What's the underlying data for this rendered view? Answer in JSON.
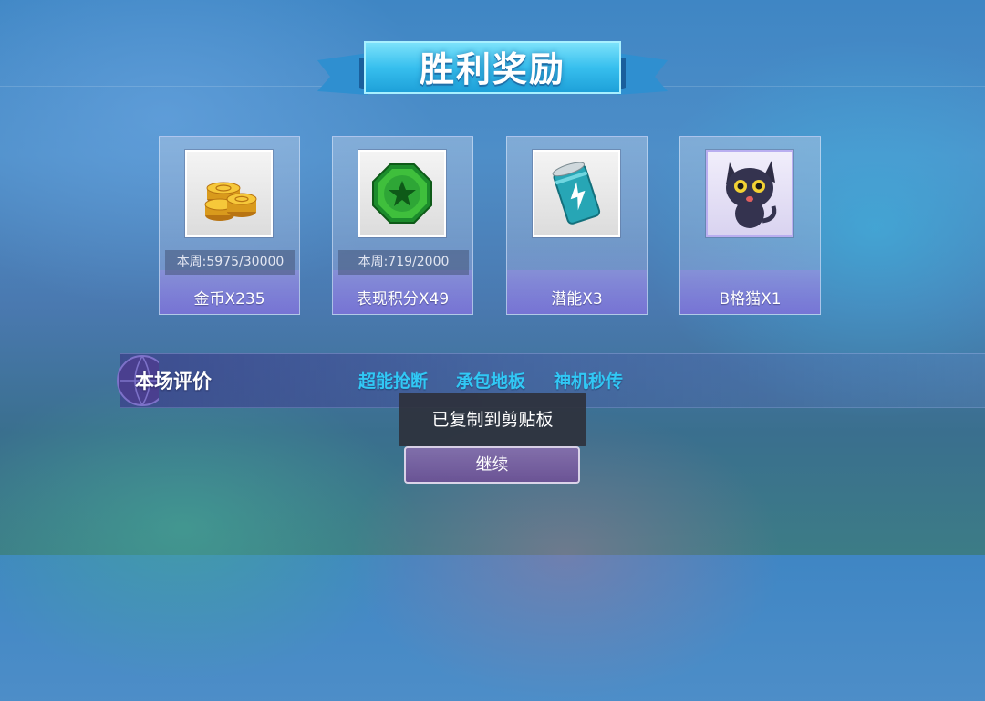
{
  "title": "胜利奖励",
  "rewards": [
    {
      "icon": "gold-coins-icon",
      "weekly": "本周:5975/30000",
      "label": "金币X235"
    },
    {
      "icon": "green-star-gem-icon",
      "weekly": "本周:719/2000",
      "label": "表现积分X49"
    },
    {
      "icon": "energy-can-icon",
      "label": "潜能X3"
    },
    {
      "icon": "black-cat-icon",
      "label": "B格猫X1"
    }
  ],
  "evaluation": {
    "title": "本场评价",
    "tags": [
      "超能抢断",
      "承包地板",
      "神机秒传"
    ]
  },
  "toast": "已复制到剪贴板",
  "continue_label": "继续",
  "colors": {
    "tag": "#31c8f5",
    "banner": "#2fb7ea"
  }
}
